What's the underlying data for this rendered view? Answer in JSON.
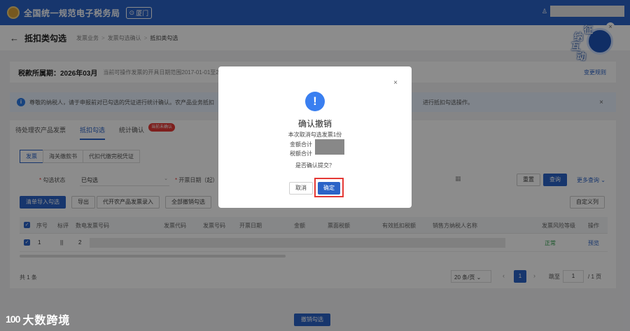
{
  "header": {
    "title": "全国统一规范电子税务局",
    "region": "厦门"
  },
  "breadcrumb": {
    "page_title": "抵扣类勾选",
    "crumbs": [
      "发票业务",
      "发票勾选确认",
      "抵扣类勾选"
    ]
  },
  "mascot": {
    "chars": [
      "征",
      "纳",
      "互",
      "动"
    ]
  },
  "period": {
    "label": "税款所属期：2026年03月",
    "note": "当前可操作发票的开具日期范围2017-01-01至2",
    "change_rule": "变更规则"
  },
  "notice": {
    "text": "尊敬的纳税人，请于申报前对已勾选的凭证进行统计确认。农产品业务抵扣",
    "tail": "进行抵扣勾选操作。"
  },
  "tabs": [
    {
      "label": "待处理农产品发票"
    },
    {
      "label": "抵扣勾选"
    },
    {
      "label": "统计确认",
      "badge": "当前未确认"
    }
  ],
  "sub_tabs": [
    {
      "label": "发票"
    },
    {
      "label": "海关缴款书"
    },
    {
      "label": "代扣代缴完税凭证"
    }
  ],
  "filters": {
    "select_status_label": "勾选状态",
    "select_status_value": "已勾选",
    "date_label": "开票日期（起）",
    "reset": "重置",
    "query": "查询",
    "more_query": "更多查询"
  },
  "actions": {
    "import_clear": "清单导入勾选",
    "export": "导出",
    "agri_import": "代开农产品发票录入",
    "cancel_all": "全部撤销勾选",
    "custom_columns": "自定义列"
  },
  "table": {
    "headers": [
      "序号",
      "标评",
      "数电发票号码",
      "发票代码",
      "发票号码",
      "开票日期",
      "金额",
      "票面税额",
      "有效抵扣税额",
      "销售方纳税人名称",
      "发票风险等级",
      "操作"
    ],
    "rows": [
      {
        "index": "1",
        "flag": "||",
        "number_prefix": "2",
        "risk": "正常",
        "action": "预览"
      }
    ]
  },
  "pagination": {
    "total": "共 1 条",
    "page_size": "20 条/页",
    "current": "1",
    "jump_label": "跳至",
    "jump_value": "1",
    "of_pages": "/ 1 页"
  },
  "bottom_button": "撤销勾选",
  "modal": {
    "title": "确认撤销",
    "line1": "本次取消勾选发票1份",
    "line2": "金额合计",
    "line3": "税额合计",
    "question": "是否确认提交？",
    "cancel": "取消",
    "confirm": "确定"
  },
  "watermark": {
    "logo": "100",
    "text": "大数跨境"
  },
  "colors": {
    "primary": "#2b63c7",
    "danger": "#e53935",
    "success": "#2e9d4b"
  }
}
